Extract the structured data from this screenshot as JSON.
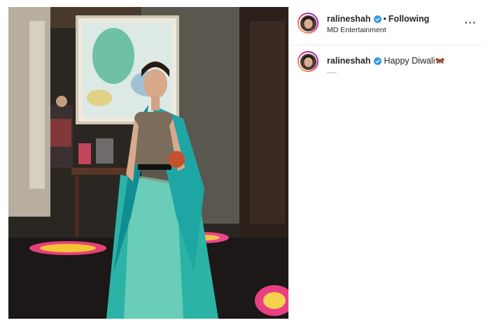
{
  "post": {
    "username": "ralineshah",
    "follow_separator": "•",
    "follow_label": "Following",
    "location": "MD Entertainment",
    "more_label": "···"
  },
  "caption": {
    "username": "ralineshah",
    "text": "Happy Diwali"
  },
  "icons": {
    "verified": "verified-badge-icon",
    "more": "more-options-icon",
    "emoji": "butterfly-emoji-icon"
  },
  "colors": {
    "verified_blue": "#3897f0",
    "story_ring_start": "#f9ce34",
    "story_ring_end": "#6228d7",
    "dress_teal": "#2bb3a6"
  }
}
